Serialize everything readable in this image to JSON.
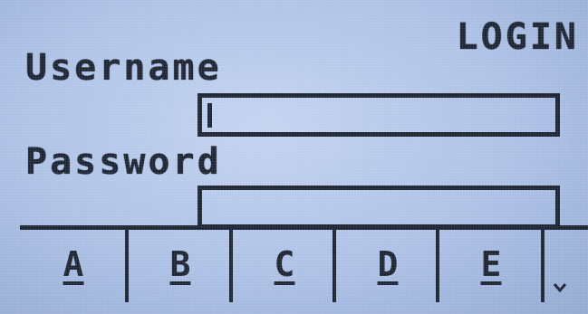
{
  "screen": {
    "title": "LOGIN"
  },
  "form": {
    "username_label": "Username",
    "username_value": "",
    "password_label": "Password",
    "password_value": ""
  },
  "softkeys": [
    {
      "label": "A"
    },
    {
      "label": "B"
    },
    {
      "label": "C"
    },
    {
      "label": "D"
    },
    {
      "label": "E"
    }
  ],
  "more_icon": "chevron-down-icon",
  "colors": {
    "lcd_background": "#adc1e6",
    "pixel_ink": "#1d2433"
  }
}
